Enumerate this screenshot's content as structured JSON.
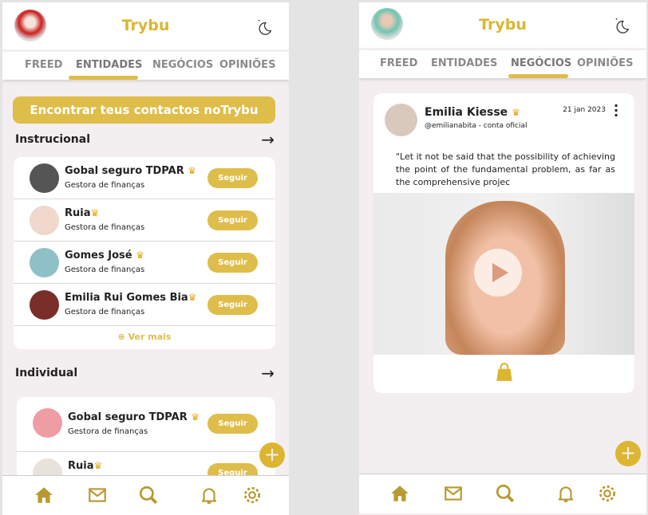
{
  "app": {
    "title": "Trybu"
  },
  "tabs": [
    "FREED",
    "ENTIDADES",
    "NEGÓCIOS",
    "OPINIÕES"
  ],
  "left": {
    "active_tab": "ENTIDADES",
    "find_button": "Encontrar teus contactos noTrybu",
    "sections": [
      {
        "title": "Instrucional",
        "items": [
          {
            "name": "Gobal seguro TDPAR",
            "role": "Gestora de finanças",
            "follow": "Seguir"
          },
          {
            "name": "Ruia",
            "role": "Gestora de finanças",
            "follow": "Seguir"
          },
          {
            "name": "Gomes José",
            "role": "Gestora de finanças",
            "follow": "Seguir"
          },
          {
            "name": "Emilia Rui Gomes Bia",
            "role": "Gestora de finanças",
            "follow": "Seguir"
          }
        ],
        "more": "Ver mais"
      },
      {
        "title": "Individual",
        "items": [
          {
            "name": "Gobal seguro TDPAR",
            "role": "Gestora de finanças",
            "follow": "Seguir"
          },
          {
            "name": "Ruia",
            "role": "",
            "follow": "Seguir"
          }
        ]
      }
    ]
  },
  "right": {
    "active_tab": "NEGÓCIOS",
    "post": {
      "author": "Emilia Kiesse",
      "handle": "@emilianabita - conta oficial",
      "date": "21 jan 2023",
      "text": "\"Let it not be said that the possibility of achieving the point of the fundamental problem, as far as the comprehensive projec"
    }
  },
  "icons": {
    "crown": "♛",
    "fab": "+",
    "more": "ⓘ"
  },
  "colors": {
    "accent": "#dfbd4a",
    "title": "#dcb631",
    "nav_icon": "#b89a30",
    "background": "#f3eef0"
  }
}
